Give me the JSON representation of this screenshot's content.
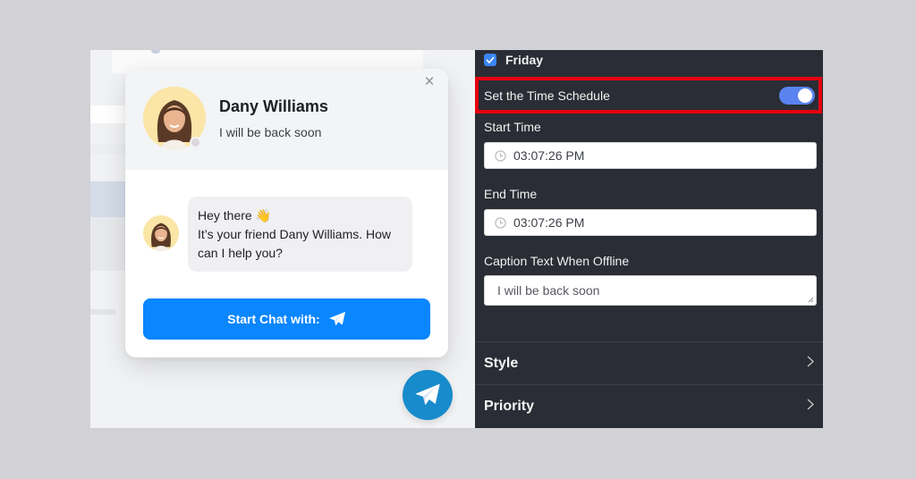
{
  "chat_widget": {
    "agent_name": "Dany Williams",
    "agent_status": "I will be back soon",
    "close_label": "×",
    "message_line1": "Hey there 👋",
    "message_line2": "It’s your friend Dany Williams. How can I help you?",
    "start_button_label": "Start Chat with:",
    "colors": {
      "button": "#0a86ff",
      "fab": "#178bcb"
    }
  },
  "settings_panel": {
    "friday": {
      "label": "Friday",
      "checked": true
    },
    "time_schedule": {
      "label": "Set the Time Schedule",
      "enabled": true
    },
    "start_time": {
      "label": "Start Time",
      "value": "03:07:26 PM"
    },
    "end_time": {
      "label": "End Time",
      "value": "03:07:26 PM"
    },
    "caption": {
      "label": "Caption Text When Offline",
      "value": "I will be back soon"
    },
    "sections": [
      {
        "label": "Style"
      },
      {
        "label": "Priority"
      }
    ],
    "colors": {
      "highlight_border": "#e6000f",
      "toggle": "#5a83ef",
      "panel_bg": "#2a2d35"
    }
  }
}
